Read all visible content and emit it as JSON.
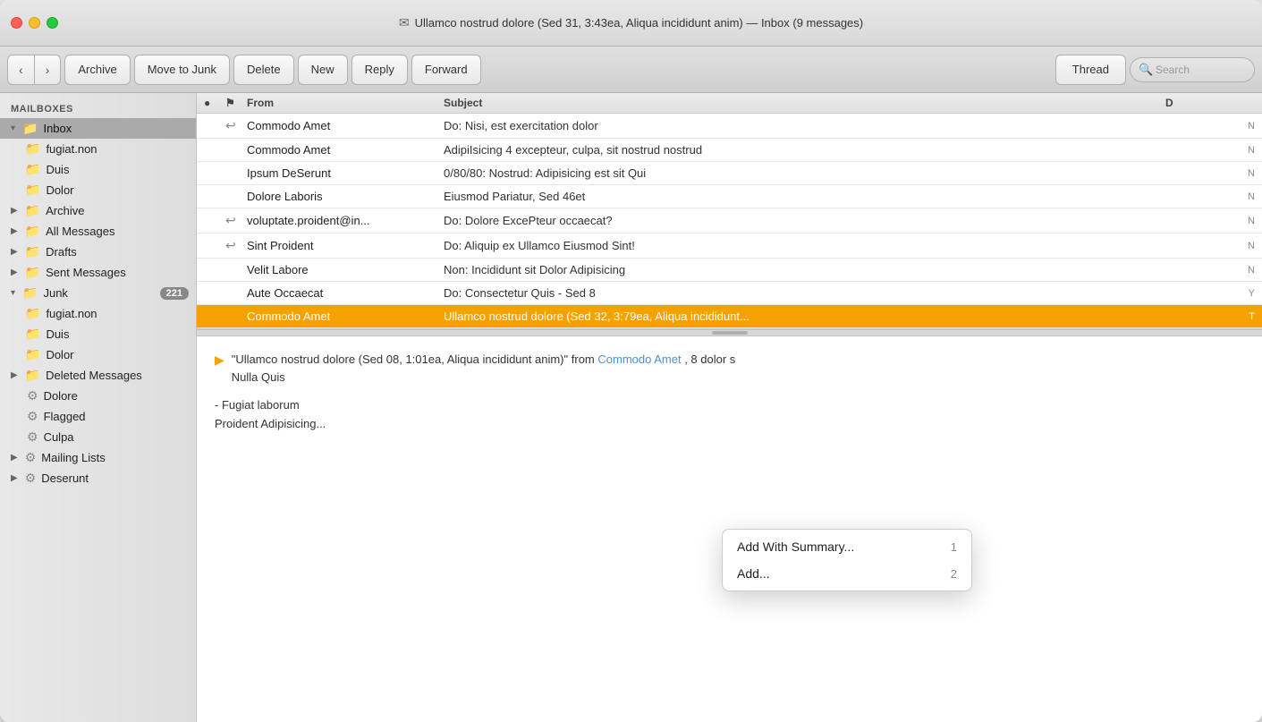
{
  "window": {
    "title": "Ullamco nostrud dolore (Sed 31, 3:43ea, Aliqua incididunt anim) — Inbox (9 messages)"
  },
  "toolbar": {
    "back_label": "‹",
    "forward_label": "›",
    "archive_label": "Archive",
    "move_to_junk_label": "Move to Junk",
    "delete_label": "Delete",
    "new_label": "New",
    "reply_label": "Reply",
    "forward_label2": "Forward",
    "thread_label": "Thread",
    "search_placeholder": "Search"
  },
  "sidebar": {
    "header": "MAILBOXES",
    "items": [
      {
        "label": "Inbox",
        "type": "folder-blue",
        "expanded": true,
        "indent": 0,
        "selected": true
      },
      {
        "label": "fugiat.non",
        "type": "folder-blue",
        "indent": 1
      },
      {
        "label": "Duis",
        "type": "folder-blue",
        "indent": 1
      },
      {
        "label": "Dolor",
        "type": "folder-blue",
        "indent": 1
      },
      {
        "label": "Archive",
        "type": "folder-blue",
        "indent": 0,
        "expandable": true
      },
      {
        "label": "All Messages",
        "type": "folder-blue",
        "indent": 0,
        "expandable": true
      },
      {
        "label": "Drafts",
        "type": "folder-blue",
        "indent": 0,
        "expandable": true
      },
      {
        "label": "Sent Messages",
        "type": "folder-blue",
        "indent": 0,
        "expandable": true
      },
      {
        "label": "Junk",
        "type": "folder-blue",
        "indent": 0,
        "expanded": true,
        "badge": "221"
      },
      {
        "label": "fugiat.non",
        "type": "folder-blue",
        "indent": 1
      },
      {
        "label": "Duis",
        "type": "folder-blue",
        "indent": 1
      },
      {
        "label": "Dolor",
        "type": "folder-blue",
        "indent": 1
      },
      {
        "label": "Deleted Messages",
        "type": "folder-blue",
        "indent": 0,
        "expandable": true
      },
      {
        "label": "Dolore",
        "type": "gear",
        "indent": 0
      },
      {
        "label": "Flagged",
        "type": "gear",
        "indent": 0
      },
      {
        "label": "Culpa",
        "type": "gear",
        "indent": 0
      },
      {
        "label": "Mailing Lists",
        "type": "gear",
        "indent": 0,
        "expandable": true
      },
      {
        "label": "Deserunt",
        "type": "gear",
        "indent": 0,
        "expandable": true
      }
    ]
  },
  "email_list": {
    "columns": [
      "",
      "",
      "From",
      "Subject",
      "Date"
    ],
    "rows": [
      {
        "has_dot": true,
        "replied": true,
        "from": "Commodo Amet",
        "subject": "Do: Nisi, est exercitation dolor",
        "date": "N",
        "selected": false
      },
      {
        "has_dot": false,
        "replied": false,
        "from": "Commodo Amet",
        "subject": "AdipiIsicing 4 excepteur, culpa, sit nostrud nostrud",
        "date": "N",
        "selected": false
      },
      {
        "has_dot": false,
        "replied": false,
        "from": "Ipsum DeSerunt",
        "subject": "0/80/80: Nostrud: Adipisicing est sit Qui",
        "date": "N",
        "selected": false
      },
      {
        "has_dot": false,
        "replied": false,
        "from": "Dolore Laboris",
        "subject": "Eiusmod Pariatur, Sed 46et",
        "date": "N",
        "selected": false
      },
      {
        "has_dot": false,
        "replied": true,
        "from": "voluptate.proident@in...",
        "subject": "Do: Dolore ExcePteur occaecat?",
        "date": "N",
        "selected": false
      },
      {
        "has_dot": false,
        "replied": true,
        "from": "Sint Proident",
        "subject": "Do: Aliquip ex Ullamco Eiusmod Sint!",
        "date": "N",
        "selected": false
      },
      {
        "has_dot": false,
        "replied": false,
        "from": "Velit Labore",
        "subject": "Non: Incididunt sit Dolor Adipisicing",
        "date": "N",
        "selected": false
      },
      {
        "has_dot": false,
        "replied": false,
        "from": "Aute Occaecat",
        "subject": "Do: Consectetur Quis - Sed 8",
        "date": "Y",
        "selected": false
      },
      {
        "has_dot": false,
        "replied": false,
        "from": "Commodo Amet",
        "subject": "Ullamco nostrud dolore (Sed 32, 3:79ea, Aliqua incididunt...",
        "date": "T",
        "selected": true
      }
    ]
  },
  "context_menu": {
    "items": [
      {
        "label": "Add With Summary...",
        "shortcut": "1"
      },
      {
        "label": "Add...",
        "shortcut": "2"
      }
    ]
  },
  "preview": {
    "triangle": "▶",
    "quote_start": "“Ullamco nostrud dolore (Sed 08, 1:01ea, Aliqua incididunt anim)”",
    "from_label": "from",
    "from_value": "Commodo Amet",
    "tail": ", 8 dolor s",
    "continuation": "Nulla Quis",
    "body": "- Fugiat laborum",
    "body2": "Proident Adipisicing..."
  }
}
